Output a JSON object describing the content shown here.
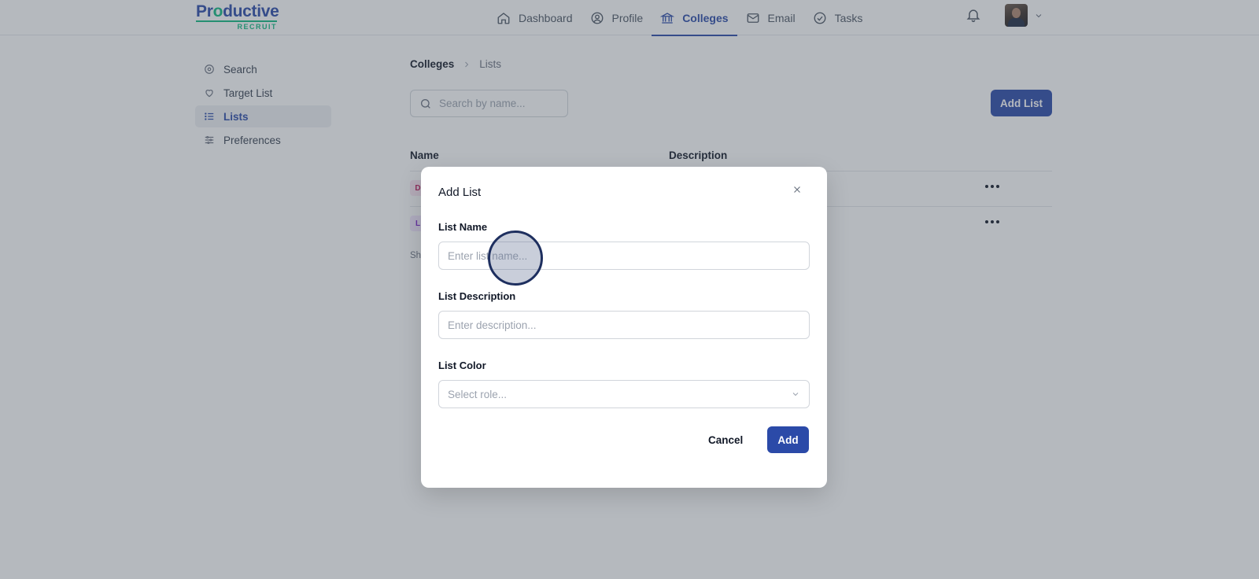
{
  "brand": {
    "name_prefix": "Pr",
    "name_o": "o",
    "name_suffix": "ductive",
    "tagline": "RECRUIT"
  },
  "nav": [
    {
      "label": "Dashboard",
      "icon": "home-icon"
    },
    {
      "label": "Profile",
      "icon": "user-circle-icon"
    },
    {
      "label": "Colleges",
      "icon": "building-columns-icon",
      "active": true
    },
    {
      "label": "Email",
      "icon": "envelope-icon"
    },
    {
      "label": "Tasks",
      "icon": "check-circle-icon"
    }
  ],
  "sidebar": {
    "items": [
      {
        "label": "Search",
        "icon": "compass-icon"
      },
      {
        "label": "Target List",
        "icon": "heart-icon"
      },
      {
        "label": "Lists",
        "icon": "list-icon",
        "active": true
      },
      {
        "label": "Preferences",
        "icon": "sliders-icon"
      }
    ]
  },
  "breadcrumb": {
    "root": "Colleges",
    "current": "Lists"
  },
  "search": {
    "placeholder": "Search by name..."
  },
  "toolbar": {
    "add_list_label": "Add List"
  },
  "table": {
    "columns": [
      "Name",
      "Description"
    ],
    "rows": [
      {
        "badge": "D"
      },
      {
        "badge": "L"
      }
    ],
    "footer_text": "Sh"
  },
  "modal": {
    "title": "Add List",
    "name_label": "List Name",
    "name_placeholder": "Enter list name...",
    "description_label": "List Description",
    "description_placeholder": "Enter description...",
    "color_label": "List Color",
    "color_placeholder": "Select role...",
    "cancel_label": "Cancel",
    "add_label": "Add"
  },
  "colors": {
    "primary": "#2b4aa8",
    "brand_green": "#10b981"
  }
}
